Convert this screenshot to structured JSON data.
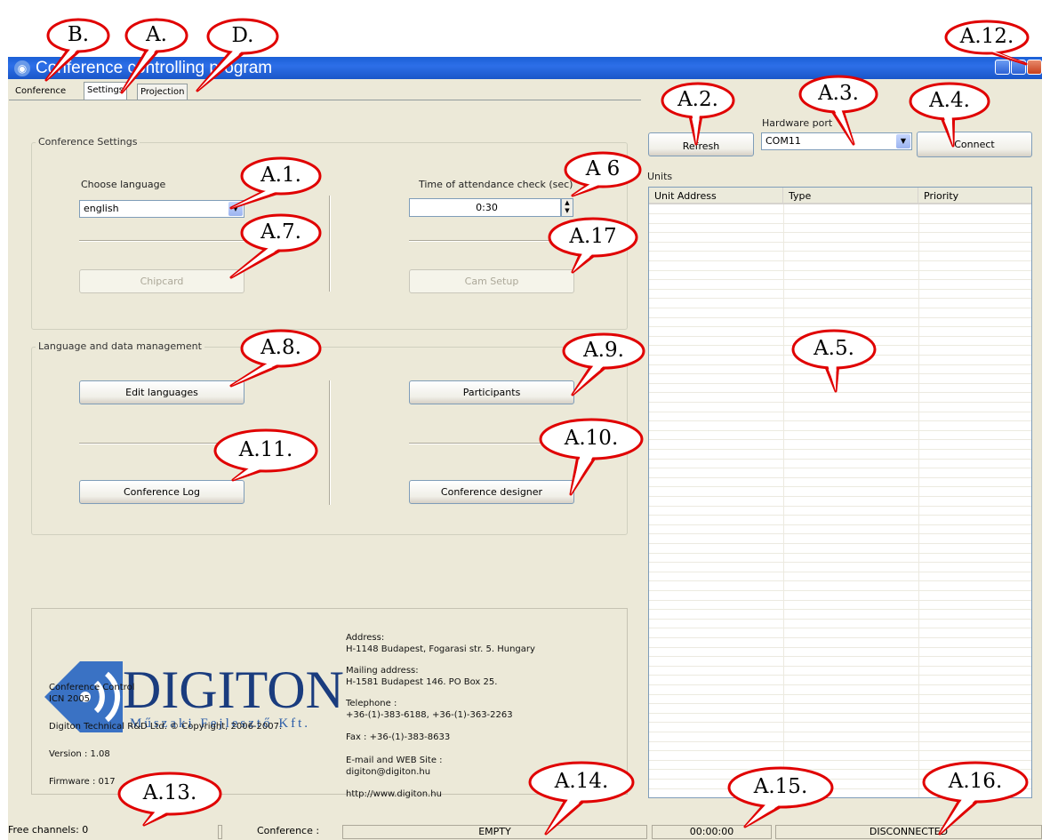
{
  "window": {
    "title": "Conference controlling program"
  },
  "tabs": [
    "Conference",
    "Settings",
    "Projection"
  ],
  "conference_settings": {
    "group_label": "Conference Settings",
    "choose_language_label": "Choose language",
    "language_value": "english",
    "attendance_label": "Time of attendance check (sec)",
    "attendance_value": "0:30",
    "chipcard_label": "Chipcard",
    "cam_setup_label": "Cam Setup"
  },
  "language_data": {
    "group_label": "Language and data management",
    "edit_languages": "Edit languages",
    "participants": "Participants",
    "conference_log": "Conference Log",
    "conference_designer": "Conference designer"
  },
  "hardware": {
    "refresh": "Refresh",
    "port_label": "Hardware port",
    "port_value": "COM11",
    "connect": "Connect",
    "units_label": "Units",
    "columns": [
      "Unit Address",
      "Type",
      "Priority"
    ]
  },
  "info": {
    "logo_word": "DIGITON",
    "logo_sub": "Műszaki Fejlesztő Kft.",
    "product": "Conference Control",
    "product_code": "ICN 2005",
    "copyright": "Digiton Technical R&D Ltd. © Copyright, 2006-2007.",
    "version": "Version : 1.08",
    "firmware": "Firmware : 017",
    "address_label": "Address:",
    "address": "H-1148 Budapest, Fogarasi str. 5. Hungary",
    "mailing_label": "Mailing address:",
    "mailing": "H-1581 Budapest 146.  PO Box 25.",
    "telephone_label": "Telephone :",
    "telephone": "+36-(1)-383-6188, +36-(1)-363-2263",
    "fax": "Fax : +36-(1)-383-8633",
    "email_label": "E-mail and WEB Site :",
    "email": "digiton@digiton.hu",
    "web": "http://www.digiton.hu"
  },
  "status": {
    "free_channels": "Free channels: 0",
    "conference_label": "Conference :",
    "conference_state": "EMPTY",
    "time": "00:00:00",
    "connection": "DISCONNECTED"
  },
  "callouts": {
    "B": "B.",
    "A": "A.",
    "D": "D.",
    "A12": "A.12.",
    "A2": "A.2.",
    "A3": "A.3.",
    "A4": "A.4.",
    "A1": "A.1.",
    "A6": "A 6",
    "A7": "A.7.",
    "A17": "A.17",
    "A8": "A.8.",
    "A9": "A.9.",
    "A5": "A.5.",
    "A11": "A.11.",
    "A10": "A.10.",
    "A13": "A.13.",
    "A14": "A.14.",
    "A15": "A.15.",
    "A16": "A.16."
  },
  "colors": {
    "titlebar": "#2d6fe8",
    "window_bg": "#ece9d8",
    "callout_border": "#e00000",
    "logo_blue": "#3a72c4",
    "logo_text": "#1a3c7e"
  }
}
